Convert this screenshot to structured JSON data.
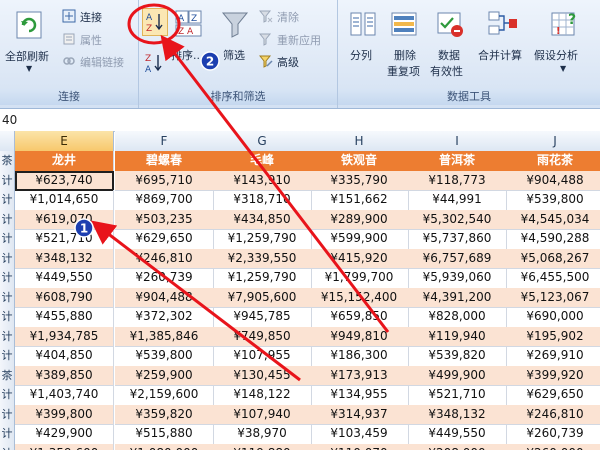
{
  "ribbon": {
    "groups": [
      {
        "label": "连接",
        "buttons": {
          "refresh_all": "全部刷新",
          "connections": "连接",
          "properties": "属性",
          "edit_links": "编辑链接"
        }
      },
      {
        "label": "排序和筛选",
        "buttons": {
          "sort": "排序...",
          "filter": "筛选",
          "clear": "清除",
          "reapply": "重新应用",
          "advanced": "高级"
        }
      },
      {
        "label": "数据工具",
        "buttons": {
          "text_to_columns": "分列",
          "remove_duplicates_1": "删除",
          "remove_duplicates_2": "重复项",
          "data_validation_1": "数据",
          "data_validation_2": "有效性",
          "consolidate": "合并计算",
          "what_if_analysis": "假设分析"
        }
      }
    ]
  },
  "formula_bar": {
    "value": "40"
  },
  "sheet": {
    "columns": [
      "E",
      "F",
      "G",
      "H",
      "I",
      "J"
    ],
    "header_row": [
      "龙井",
      "碧螺春",
      "毛峰",
      "铁观音",
      "普洱茶",
      "雨花茶"
    ],
    "row_header_chars": [
      "茶",
      "计",
      "计",
      "计",
      "计",
      "计",
      "计",
      "计",
      "计",
      "计",
      "计",
      "茶",
      "计",
      "计",
      "计",
      "计"
    ],
    "rows": [
      [
        "¥623,740",
        "¥695,710",
        "¥143,910",
        "¥335,790",
        "¥118,773",
        "¥904,488"
      ],
      [
        "¥1,014,650",
        "¥869,700",
        "¥318,710",
        "¥151,662",
        "¥44,991",
        "¥539,800"
      ],
      [
        "¥619,070",
        "¥503,235",
        "¥434,850",
        "¥289,900",
        "¥5,302,540",
        "¥4,545,034"
      ],
      [
        "¥521,710",
        "¥629,650",
        "¥1,259,790",
        "¥599,900",
        "¥5,737,860",
        "¥4,590,288"
      ],
      [
        "¥348,132",
        "¥246,810",
        "¥2,339,550",
        "¥415,920",
        "¥6,757,689",
        "¥5,068,267"
      ],
      [
        "¥449,550",
        "¥260,739",
        "¥1,259,790",
        "¥1,799,700",
        "¥5,939,060",
        "¥6,455,500"
      ],
      [
        "¥608,790",
        "¥904,488",
        "¥7,905,600",
        "¥15,152,400",
        "¥4,391,200",
        "¥5,123,067"
      ],
      [
        "¥455,880",
        "¥372,302",
        "¥945,785",
        "¥659,850",
        "¥828,000",
        "¥690,000"
      ],
      [
        "¥1,934,785",
        "¥1,385,846",
        "¥749,850",
        "¥949,810",
        "¥119,940",
        "¥195,902"
      ],
      [
        "¥404,850",
        "¥539,800",
        "¥107,955",
        "¥186,300",
        "¥539,820",
        "¥269,910"
      ],
      [
        "¥389,850",
        "¥259,900",
        "¥130,455",
        "¥173,913",
        "¥499,900",
        "¥399,920"
      ],
      [
        "¥1,403,740",
        "¥2,159,600",
        "¥148,122",
        "¥134,955",
        "¥521,710",
        "¥629,650"
      ],
      [
        "¥399,800",
        "¥359,820",
        "¥107,940",
        "¥314,937",
        "¥348,132",
        "¥246,810"
      ],
      [
        "¥429,900",
        "¥515,880",
        "¥38,970",
        "¥103,459",
        "¥449,550",
        "¥260,739"
      ],
      [
        "¥1,359,600",
        "¥1,080,000",
        "¥119,880",
        "¥110,070",
        "¥208,000",
        "¥260,000"
      ]
    ]
  },
  "annotations": {
    "marker_1": "1",
    "marker_2": "2"
  },
  "colors": {
    "header_fill": "#ed7d31",
    "alt_row_fill": "#fbe3d3",
    "annotation_red": "#e8141b",
    "marker_blue": "#1d3fb0"
  },
  "icons": [
    "refresh-icon",
    "connections-icon",
    "properties-icon",
    "edit-links-icon",
    "sort-az-icon",
    "sort-za-icon",
    "sort-dialog-icon",
    "filter-icon",
    "clear-filter-icon",
    "reapply-icon",
    "advanced-filter-icon",
    "text-to-columns-icon",
    "remove-duplicates-icon",
    "data-validation-icon",
    "consolidate-icon",
    "what-if-icon"
  ]
}
